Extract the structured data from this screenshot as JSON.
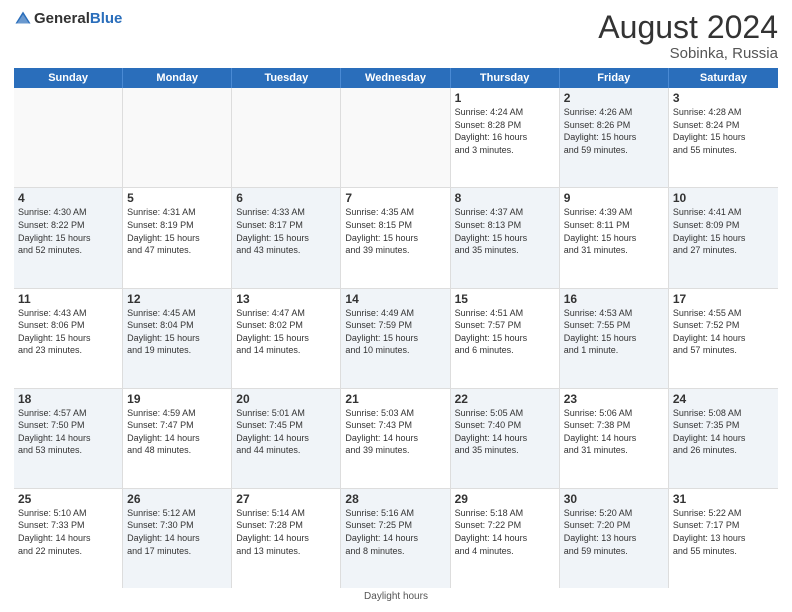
{
  "header": {
    "logo_general": "General",
    "logo_blue": "Blue",
    "title": "August 2024",
    "subtitle": "Sobinka, Russia"
  },
  "days_of_week": [
    "Sunday",
    "Monday",
    "Tuesday",
    "Wednesday",
    "Thursday",
    "Friday",
    "Saturday"
  ],
  "footer": {
    "note": "Daylight hours"
  },
  "weeks": [
    [
      {
        "day": "",
        "info": "",
        "shaded": false,
        "empty": true
      },
      {
        "day": "",
        "info": "",
        "shaded": false,
        "empty": true
      },
      {
        "day": "",
        "info": "",
        "shaded": false,
        "empty": true
      },
      {
        "day": "",
        "info": "",
        "shaded": false,
        "empty": true
      },
      {
        "day": "1",
        "info": "Sunrise: 4:24 AM\nSunset: 8:28 PM\nDaylight: 16 hours\nand 3 minutes.",
        "shaded": false,
        "empty": false
      },
      {
        "day": "2",
        "info": "Sunrise: 4:26 AM\nSunset: 8:26 PM\nDaylight: 15 hours\nand 59 minutes.",
        "shaded": true,
        "empty": false
      },
      {
        "day": "3",
        "info": "Sunrise: 4:28 AM\nSunset: 8:24 PM\nDaylight: 15 hours\nand 55 minutes.",
        "shaded": false,
        "empty": false
      }
    ],
    [
      {
        "day": "4",
        "info": "Sunrise: 4:30 AM\nSunset: 8:22 PM\nDaylight: 15 hours\nand 52 minutes.",
        "shaded": true,
        "empty": false
      },
      {
        "day": "5",
        "info": "Sunrise: 4:31 AM\nSunset: 8:19 PM\nDaylight: 15 hours\nand 47 minutes.",
        "shaded": false,
        "empty": false
      },
      {
        "day": "6",
        "info": "Sunrise: 4:33 AM\nSunset: 8:17 PM\nDaylight: 15 hours\nand 43 minutes.",
        "shaded": true,
        "empty": false
      },
      {
        "day": "7",
        "info": "Sunrise: 4:35 AM\nSunset: 8:15 PM\nDaylight: 15 hours\nand 39 minutes.",
        "shaded": false,
        "empty": false
      },
      {
        "day": "8",
        "info": "Sunrise: 4:37 AM\nSunset: 8:13 PM\nDaylight: 15 hours\nand 35 minutes.",
        "shaded": true,
        "empty": false
      },
      {
        "day": "9",
        "info": "Sunrise: 4:39 AM\nSunset: 8:11 PM\nDaylight: 15 hours\nand 31 minutes.",
        "shaded": false,
        "empty": false
      },
      {
        "day": "10",
        "info": "Sunrise: 4:41 AM\nSunset: 8:09 PM\nDaylight: 15 hours\nand 27 minutes.",
        "shaded": true,
        "empty": false
      }
    ],
    [
      {
        "day": "11",
        "info": "Sunrise: 4:43 AM\nSunset: 8:06 PM\nDaylight: 15 hours\nand 23 minutes.",
        "shaded": false,
        "empty": false
      },
      {
        "day": "12",
        "info": "Sunrise: 4:45 AM\nSunset: 8:04 PM\nDaylight: 15 hours\nand 19 minutes.",
        "shaded": true,
        "empty": false
      },
      {
        "day": "13",
        "info": "Sunrise: 4:47 AM\nSunset: 8:02 PM\nDaylight: 15 hours\nand 14 minutes.",
        "shaded": false,
        "empty": false
      },
      {
        "day": "14",
        "info": "Sunrise: 4:49 AM\nSunset: 7:59 PM\nDaylight: 15 hours\nand 10 minutes.",
        "shaded": true,
        "empty": false
      },
      {
        "day": "15",
        "info": "Sunrise: 4:51 AM\nSunset: 7:57 PM\nDaylight: 15 hours\nand 6 minutes.",
        "shaded": false,
        "empty": false
      },
      {
        "day": "16",
        "info": "Sunrise: 4:53 AM\nSunset: 7:55 PM\nDaylight: 15 hours\nand 1 minute.",
        "shaded": true,
        "empty": false
      },
      {
        "day": "17",
        "info": "Sunrise: 4:55 AM\nSunset: 7:52 PM\nDaylight: 14 hours\nand 57 minutes.",
        "shaded": false,
        "empty": false
      }
    ],
    [
      {
        "day": "18",
        "info": "Sunrise: 4:57 AM\nSunset: 7:50 PM\nDaylight: 14 hours\nand 53 minutes.",
        "shaded": true,
        "empty": false
      },
      {
        "day": "19",
        "info": "Sunrise: 4:59 AM\nSunset: 7:47 PM\nDaylight: 14 hours\nand 48 minutes.",
        "shaded": false,
        "empty": false
      },
      {
        "day": "20",
        "info": "Sunrise: 5:01 AM\nSunset: 7:45 PM\nDaylight: 14 hours\nand 44 minutes.",
        "shaded": true,
        "empty": false
      },
      {
        "day": "21",
        "info": "Sunrise: 5:03 AM\nSunset: 7:43 PM\nDaylight: 14 hours\nand 39 minutes.",
        "shaded": false,
        "empty": false
      },
      {
        "day": "22",
        "info": "Sunrise: 5:05 AM\nSunset: 7:40 PM\nDaylight: 14 hours\nand 35 minutes.",
        "shaded": true,
        "empty": false
      },
      {
        "day": "23",
        "info": "Sunrise: 5:06 AM\nSunset: 7:38 PM\nDaylight: 14 hours\nand 31 minutes.",
        "shaded": false,
        "empty": false
      },
      {
        "day": "24",
        "info": "Sunrise: 5:08 AM\nSunset: 7:35 PM\nDaylight: 14 hours\nand 26 minutes.",
        "shaded": true,
        "empty": false
      }
    ],
    [
      {
        "day": "25",
        "info": "Sunrise: 5:10 AM\nSunset: 7:33 PM\nDaylight: 14 hours\nand 22 minutes.",
        "shaded": false,
        "empty": false
      },
      {
        "day": "26",
        "info": "Sunrise: 5:12 AM\nSunset: 7:30 PM\nDaylight: 14 hours\nand 17 minutes.",
        "shaded": true,
        "empty": false
      },
      {
        "day": "27",
        "info": "Sunrise: 5:14 AM\nSunset: 7:28 PM\nDaylight: 14 hours\nand 13 minutes.",
        "shaded": false,
        "empty": false
      },
      {
        "day": "28",
        "info": "Sunrise: 5:16 AM\nSunset: 7:25 PM\nDaylight: 14 hours\nand 8 minutes.",
        "shaded": true,
        "empty": false
      },
      {
        "day": "29",
        "info": "Sunrise: 5:18 AM\nSunset: 7:22 PM\nDaylight: 14 hours\nand 4 minutes.",
        "shaded": false,
        "empty": false
      },
      {
        "day": "30",
        "info": "Sunrise: 5:20 AM\nSunset: 7:20 PM\nDaylight: 13 hours\nand 59 minutes.",
        "shaded": true,
        "empty": false
      },
      {
        "day": "31",
        "info": "Sunrise: 5:22 AM\nSunset: 7:17 PM\nDaylight: 13 hours\nand 55 minutes.",
        "shaded": false,
        "empty": false
      }
    ]
  ]
}
